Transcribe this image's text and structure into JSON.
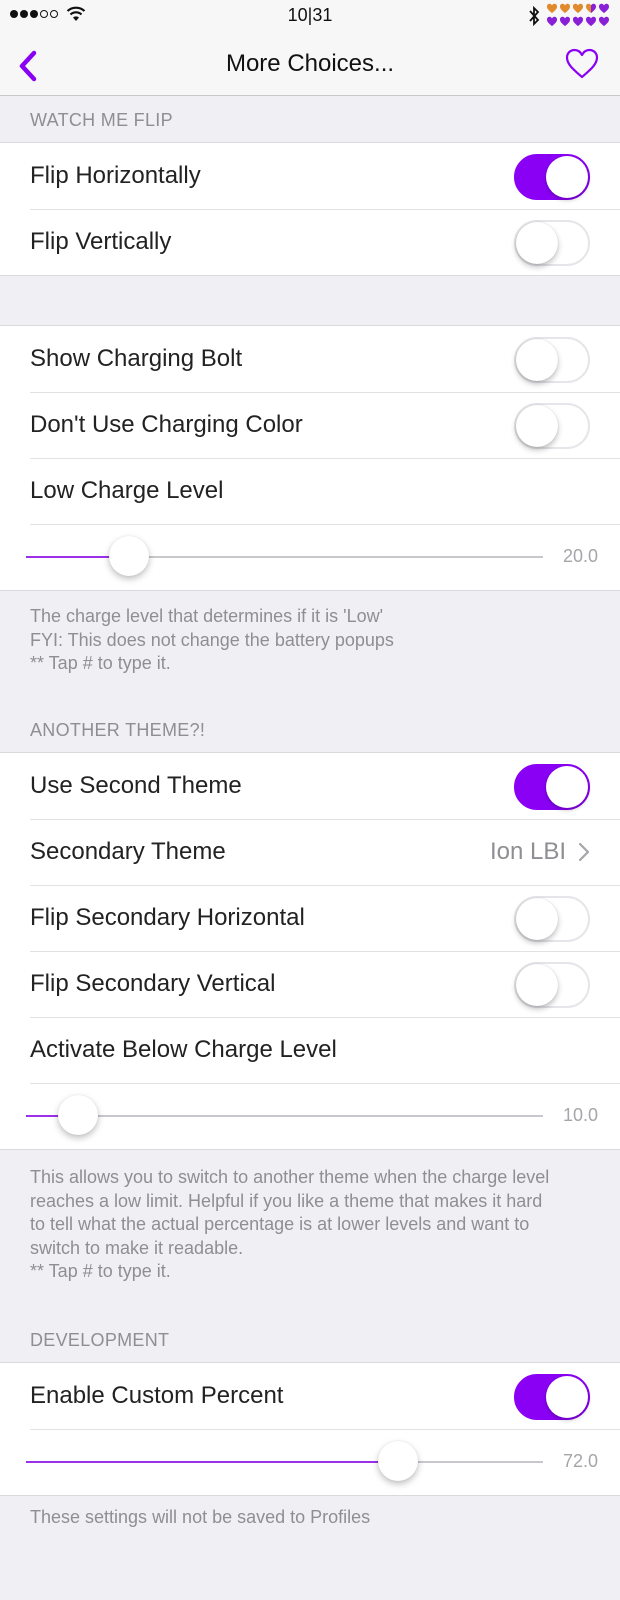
{
  "status_bar": {
    "signal_bars_filled": 3,
    "signal_bars_total": 5,
    "time": "10|31",
    "battery_hearts": {
      "total": 10,
      "orange": 3.5,
      "colors": {
        "orange": "#e08a2c",
        "purple": "#8a1fd8"
      }
    }
  },
  "nav": {
    "title": "More Choices...",
    "back_icon": "chevron-left-icon",
    "right_icon": "heart-outline-icon"
  },
  "theme": {
    "accent": "#8a00f5",
    "background": "#efeff4"
  },
  "sections": [
    {
      "header": "WATCH ME FLIP",
      "rows": [
        {
          "label": "Flip Horizontally",
          "type": "toggle",
          "value": true
        },
        {
          "label": "Flip Vertically",
          "type": "toggle",
          "value": false
        }
      ]
    },
    {
      "header": "",
      "rows": [
        {
          "label": "Show Charging Bolt",
          "type": "toggle",
          "value": false
        },
        {
          "label": "Don't Use Charging Color",
          "type": "toggle",
          "value": false
        },
        {
          "label": "Low Charge Level",
          "type": "label"
        },
        {
          "type": "slider",
          "value": 20.0,
          "min": 0,
          "max": 100,
          "display": "20.0"
        }
      ],
      "footer": [
        "The charge level that determines if it is 'Low'",
        "FYI: This does not change the battery popups",
        "** Tap # to type it."
      ]
    },
    {
      "header": "ANOTHER THEME?!",
      "rows": [
        {
          "label": "Use Second Theme",
          "type": "toggle",
          "value": true
        },
        {
          "label": "Secondary Theme",
          "type": "disclosure",
          "value": "Ion LBI"
        },
        {
          "label": "Flip Secondary Horizontal",
          "type": "toggle",
          "value": false
        },
        {
          "label": "Flip Secondary Vertical",
          "type": "toggle",
          "value": false
        },
        {
          "label": "Activate Below Charge Level",
          "type": "label"
        },
        {
          "type": "slider",
          "value": 10.0,
          "min": 0,
          "max": 100,
          "display": "10.0"
        }
      ],
      "footer": [
        "This allows you to switch to another theme when the charge level",
        "reaches a low limit. Helpful if you like a theme that makes it hard",
        "to tell what the actual percentage is at lower levels and want to",
        "switch to make it readable.",
        "** Tap # to type it."
      ]
    },
    {
      "header": "DEVELOPMENT",
      "rows": [
        {
          "label": "Enable Custom Percent",
          "type": "toggle",
          "value": true
        },
        {
          "type": "slider",
          "value": 72.0,
          "min": 0,
          "max": 100,
          "display": "72.0"
        }
      ],
      "footer": [
        "These settings will not be saved to Profiles"
      ]
    }
  ]
}
